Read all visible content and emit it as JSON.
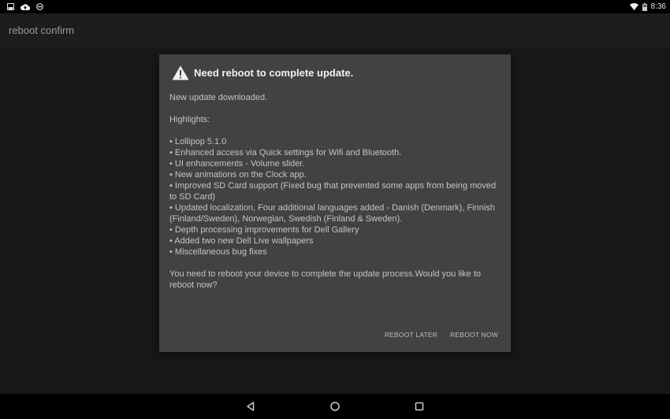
{
  "status_bar": {
    "left_icons": [
      "gallery-icon",
      "cloud-upload-icon",
      "do-not-disturb-icon"
    ],
    "right_icons": [
      "wifi-icon",
      "battery-icon"
    ],
    "time": "8:36"
  },
  "app_bar": {
    "title": "reboot confirm"
  },
  "dialog": {
    "icon": "warning-icon",
    "title": "Need reboot to complete update.",
    "intro": "New update downloaded.",
    "highlights_label": "Highlights:",
    "highlights": [
      "• Lollipop 5.1.0",
      "• Enhanced access via Quick settings for Wifi and Bluetooth.",
      "• UI enhancements - Volume slider.",
      "• New animations on the Clock app.",
      "• Improved SD Card support (Fixed bug that prevented some apps from being moved to SD Card)",
      "• Updated localization, Four additional languages added - Danish (Denmark), Finnish (Finland/Sweden), Norwegian, Swedish (Finland & Sweden).",
      "• Depth processing improvements for Dell Gallery",
      "• Added two new Dell Live wallpapers",
      "• Miscellaneous bug fixes"
    ],
    "question": "You need to reboot your device to complete the update process.Would you like to reboot now?",
    "buttons": {
      "later": "REBOOT LATER",
      "now": "REBOOT NOW"
    }
  },
  "nav_bar": {
    "buttons": [
      "back-icon",
      "home-icon",
      "recents-icon"
    ]
  },
  "colors": {
    "dialog_bg": "#424242",
    "background": "#171717",
    "bars": "#000000"
  }
}
